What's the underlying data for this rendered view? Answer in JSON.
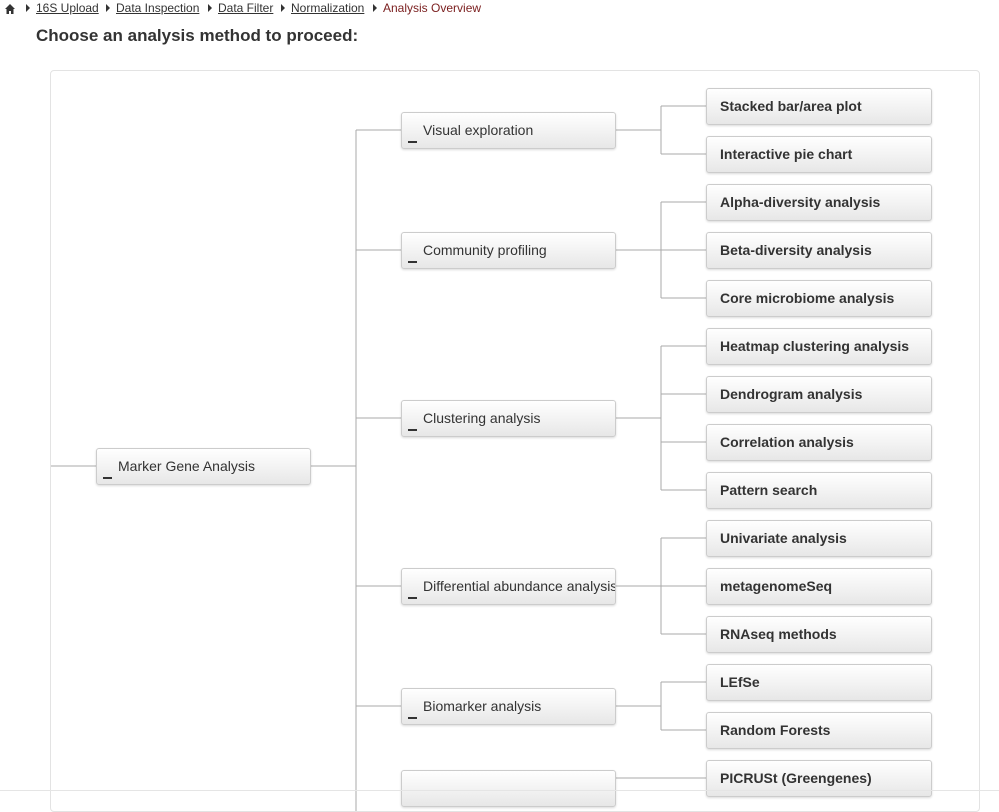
{
  "breadcrumb": {
    "links": [
      "16S Upload",
      "Data Inspection",
      "Data Filter",
      "Normalization"
    ],
    "current": "Analysis Overview"
  },
  "heading": "Choose an analysis method to proceed:",
  "tree": {
    "root": "Marker Gene Analysis",
    "categories": [
      {
        "label": "Visual exploration",
        "methods": [
          "Stacked bar/area plot",
          "Interactive pie chart"
        ]
      },
      {
        "label": "Community profiling",
        "methods": [
          "Alpha-diversity analysis",
          "Beta-diversity analysis",
          "Core microbiome analysis"
        ]
      },
      {
        "label": "Clustering analysis",
        "methods": [
          "Heatmap clustering analysis",
          "Dendrogram analysis",
          "Correlation analysis",
          "Pattern search"
        ]
      },
      {
        "label": "Differential abundance analysis",
        "methods": [
          "Univariate analysis",
          "metagenomeSeq",
          "RNAseq methods"
        ]
      },
      {
        "label": "Biomarker analysis",
        "methods": [
          "LEfSe",
          "Random Forests"
        ]
      },
      {
        "label": "",
        "methods": [
          "PICRUSt (Greengenes)"
        ]
      }
    ]
  }
}
